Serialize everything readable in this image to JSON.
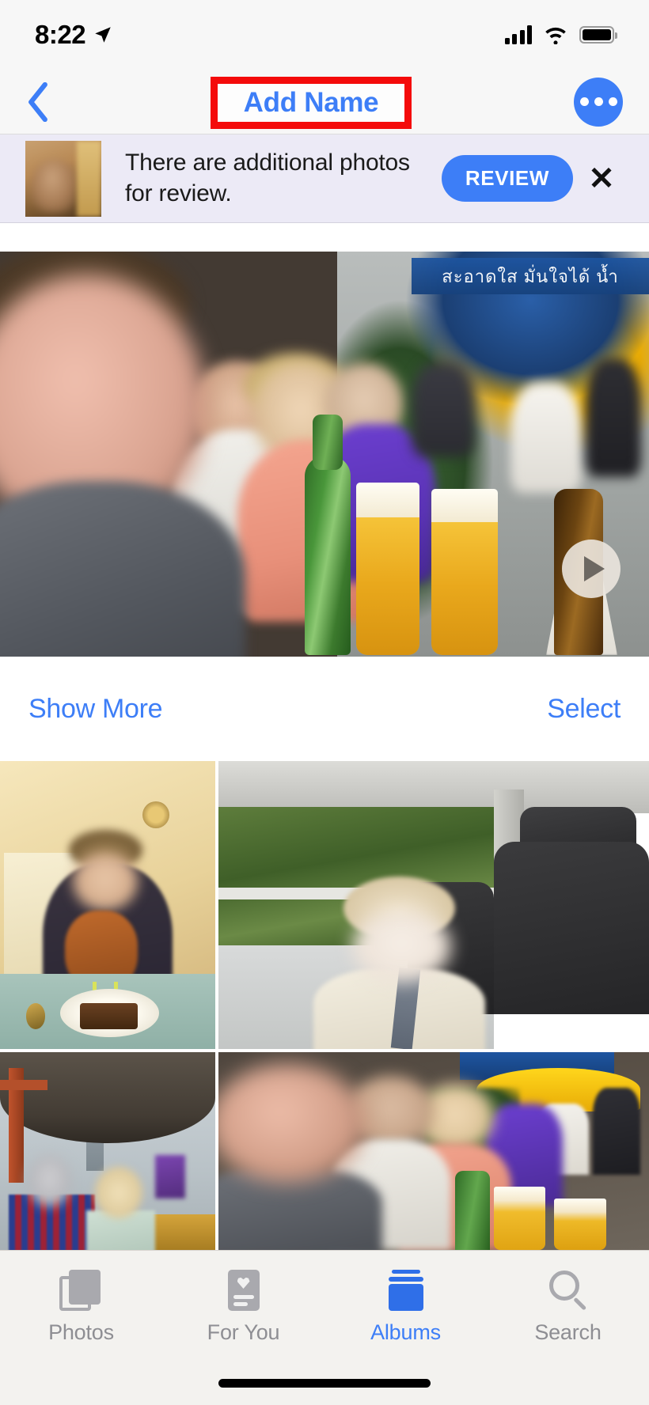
{
  "status_bar": {
    "time": "8:22",
    "location_icon": "location-arrow-icon",
    "cellular_icon": "cellular-signal-icon",
    "wifi_icon": "wifi-icon",
    "battery_icon": "battery-full-icon"
  },
  "nav_bar": {
    "back_label": "‹",
    "title": "Add Name",
    "more_label": "",
    "accent_color": "#3d7ef7",
    "highlight_box_color": "#f40b0b"
  },
  "banner": {
    "message": "There are additional photos for review.",
    "review_label": "REVIEW",
    "close_label": "✕",
    "background_color": "#eceaf6",
    "thumbnail_name": "banner-photo-thumbnail"
  },
  "hero": {
    "sign_text": "สะอาดใส มั่นใจได้ น้ำ",
    "play_button_label": "",
    "alt": "street-cafe-group-video"
  },
  "actions": {
    "show_more": "Show More",
    "select": "Select"
  },
  "grid": {
    "items": [
      {
        "name": "photo-kitchen-birthday-cake"
      },
      {
        "name": "photo-car-passenger-window"
      },
      {
        "name": "photo-tuk-tuk-riverside"
      },
      {
        "name": "photo-street-cafe-beers"
      }
    ]
  },
  "tab_bar": {
    "tabs": [
      {
        "label": "Photos",
        "icon": "photos-icon",
        "active": false
      },
      {
        "label": "For You",
        "icon": "for-you-icon",
        "active": false
      },
      {
        "label": "Albums",
        "icon": "albums-icon",
        "active": true
      },
      {
        "label": "Search",
        "icon": "search-icon",
        "active": false
      }
    ],
    "active_color": "#3d7ef7",
    "inactive_color": "#8e8e93"
  }
}
